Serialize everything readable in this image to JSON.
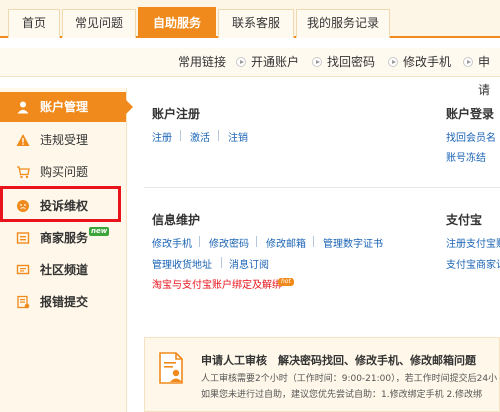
{
  "tabs": [
    "首页",
    "常见问题",
    "自助服务",
    "联系客服",
    "我的服务记录"
  ],
  "quick_links": {
    "label": "常用链接",
    "items": [
      "开通账户",
      "找回密码",
      "修改手机",
      "申请"
    ]
  },
  "sidebar": {
    "items": [
      {
        "label": "账户管理",
        "icon": "user-icon"
      },
      {
        "label": "违规受理",
        "icon": "warning-icon"
      },
      {
        "label": "购买问题",
        "icon": "cart-icon"
      },
      {
        "label": "投诉维权",
        "icon": "face-icon"
      },
      {
        "label": "商家服务",
        "icon": "store-icon",
        "badge": "new"
      },
      {
        "label": "社区频道",
        "icon": "chat-icon"
      },
      {
        "label": "报错提交",
        "icon": "report-icon"
      }
    ]
  },
  "account_register": {
    "title": "账户注册",
    "links": [
      "注册",
      "激活",
      "注销"
    ]
  },
  "account_login": {
    "title": "账户登录",
    "links": [
      "找回会员名",
      "账号冻结"
    ]
  },
  "info_maintain": {
    "title": "信息维护",
    "links_row1": [
      "修改手机",
      "修改密码",
      "修改邮箱",
      "管理数字证书"
    ],
    "links_row2": [
      "管理收货地址",
      "消息订阅"
    ],
    "links_row3": "淘宝与支付宝账户绑定及解绑",
    "hot_badge": "hot"
  },
  "alipay": {
    "title": "支付宝",
    "links": [
      "注册支付宝账",
      "支付宝商家认"
    ]
  },
  "notice": {
    "title": "申请人工审核　解决密码找回、修改手机、修改邮箱问题",
    "line1": "人工审核需要2个小时（工作时间：9:00-21:00），若工作时间提交后24小",
    "line2": "如果您未进行过自助，建议您优先尝试自助：1.修改绑定手机 2.修改绑"
  },
  "colors": {
    "accent": "#f08a1c",
    "link": "#1a63b4",
    "alert_red": "#e8131b"
  }
}
